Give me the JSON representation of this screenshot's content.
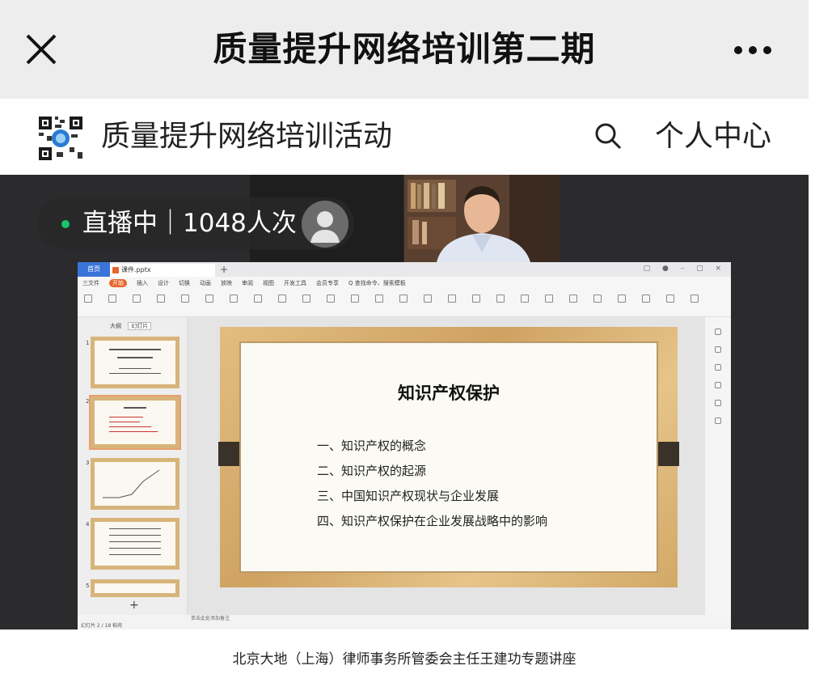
{
  "header": {
    "title": "质量提升网络培训第二期",
    "close_icon": "close-icon",
    "more_icon": "more-icon"
  },
  "account": {
    "name": "质量提升网络培训活动",
    "search_icon": "search-icon",
    "personal_label": "个人中心"
  },
  "live": {
    "status": "直播中",
    "viewers": "1048人次",
    "status_color": "#19c46a"
  },
  "wps": {
    "home_tab": "首页",
    "file_tab": "课件.pptx",
    "menu": [
      "三文件",
      "开始",
      "插入",
      "设计",
      "切换",
      "动画",
      "放映",
      "审阅",
      "视图",
      "开发工具",
      "会员专享",
      "Q 查找命令、搜索模板"
    ],
    "active_menu": "开始",
    "outline_tab": "大纲",
    "slides_tab": "幻灯片",
    "notes_placeholder": "单击此处添加备注",
    "status_text": "幻灯片 2 / 18    稻壳",
    "accent": "#e8642a"
  },
  "slide": {
    "title": "知识产权保护",
    "items": [
      "一、知识产权的概念",
      "二、知识产权的起源",
      "三、中国知识产权现状与企业发展",
      "四、知识产权保护在企业发展战略中的影响"
    ]
  },
  "caption": "北京大地（上海）律师事务所管委会主任王建功专题讲座"
}
